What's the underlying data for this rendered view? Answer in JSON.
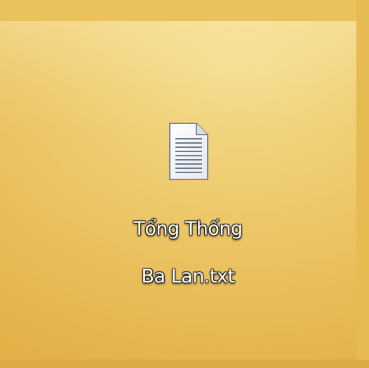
{
  "desktop": {
    "icons": [
      {
        "icon": "text-file-icon",
        "label_line1": "Tổng Thống",
        "label_line2": "Ba Lan.txt"
      }
    ]
  },
  "colors": {
    "wallpaper": "#efcd72",
    "label_text": "#ffffff",
    "label_shadow": "#1a1a1a"
  }
}
